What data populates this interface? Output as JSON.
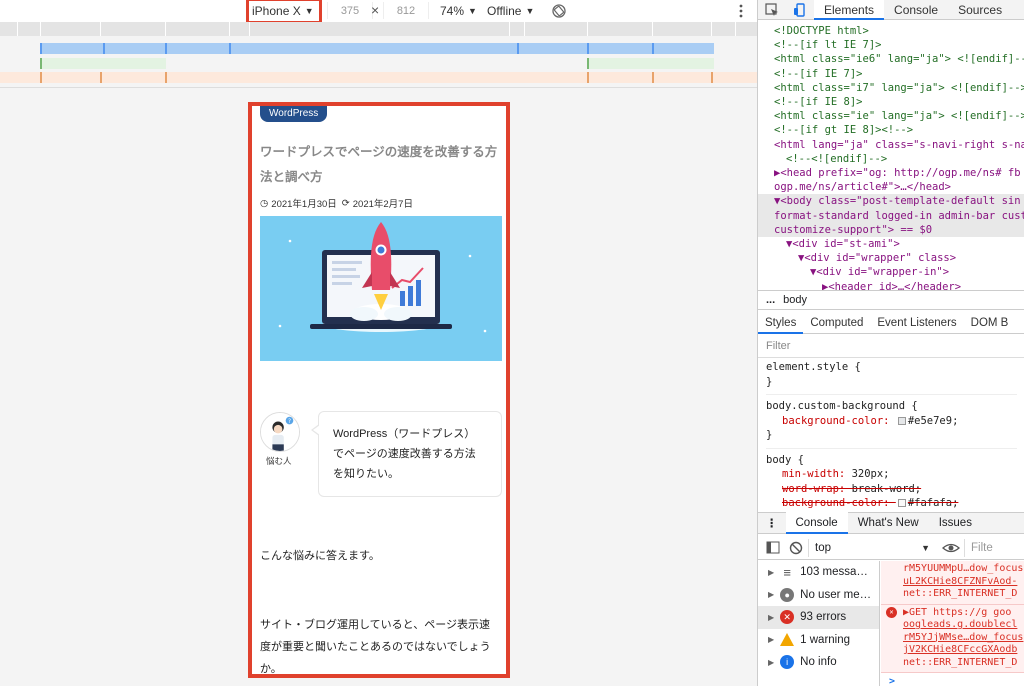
{
  "device_toolbar": {
    "device": "iPhone X",
    "width": "375",
    "times": "×",
    "height": "812",
    "zoom": "74%",
    "throttle": "Offline"
  },
  "page": {
    "category": "WordPress",
    "title": "ワードプレスでページの速度を改善する方法と調べ方",
    "published": "2021年1月30日",
    "updated": "2021年2月7日",
    "avatar_caption": "悩む人",
    "balloon_lines": [
      "WordPress（ワードプレス）",
      "でページの速度改善する方法",
      "を知りたい。"
    ],
    "para1": "こんな悩みに答えます。",
    "para2_lines": [
      "サイト・ブログ運用していると、ページ表示速",
      "度が重要と聞いたことあるのではないでしょう",
      "か。"
    ]
  },
  "devtools": {
    "tabs": [
      "Elements",
      "Console",
      "Sources"
    ],
    "tree": [
      {
        "t": "<!DOCTYPE html>",
        "cls": "c",
        "indent": 0
      },
      {
        "t": "<!--[if lt IE 7]>",
        "cls": "c",
        "indent": 0
      },
      {
        "t": "<html class=\"ie6\" lang=\"ja\"> <![endif]-->",
        "cls": "c",
        "indent": 0
      },
      {
        "t": "<!--[if IE 7]>",
        "cls": "c",
        "indent": 0
      },
      {
        "t": "<html class=\"i7\" lang=\"ja\"> <![endif]-->",
        "cls": "c",
        "indent": 0
      },
      {
        "t": "<!--[if IE 8]>",
        "cls": "c",
        "indent": 0
      },
      {
        "t": "<html class=\"ie\" lang=\"ja\"> <![endif]-->",
        "cls": "c",
        "indent": 0
      },
      {
        "t": "<!--[if gt IE 8]><!-->",
        "cls": "c",
        "indent": 0
      },
      {
        "t": "<html lang=\"ja\" class=\"s-navi-right s-navi",
        "cls": "tag",
        "indent": 0
      },
      {
        "t": "<!--<![endif]-->",
        "cls": "c",
        "indent": 1
      },
      {
        "t": "▶<head prefix=\"og: http://ogp.me/ns# fb",
        "cls": "tag",
        "indent": 0
      },
      {
        "t": "ogp.me/ns/article#\">…</head>",
        "cls": "tag",
        "indent": 0
      },
      {
        "t": "▼<body class=\"post-template-default sin",
        "cls": "tag",
        "indent": 0,
        "sel": true
      },
      {
        "t": "format-standard logged-in admin-bar cust",
        "cls": "tag",
        "indent": 0,
        "sel": true
      },
      {
        "t": "customize-support\"> == $0",
        "cls": "tag",
        "indent": 0,
        "sel": true
      },
      {
        "t": "▼<div id=\"st-ami\">",
        "cls": "tag",
        "indent": 1
      },
      {
        "t": "▼<div id=\"wrapper\" class>",
        "cls": "tag",
        "indent": 2
      },
      {
        "t": "▼<div id=\"wrapper-in\">",
        "cls": "tag",
        "indent": 3
      },
      {
        "t": "▶<header id>…</header>",
        "cls": "tag",
        "indent": 4
      }
    ],
    "breadcrumb": [
      "...",
      "body"
    ],
    "styles_tabs": [
      "Styles",
      "Computed",
      "Event Listeners",
      "DOM B"
    ],
    "filter_placeholder": "Filter",
    "style_rules": [
      {
        "selector": "element.style {",
        "props": []
      },
      {
        "selector": "body.custom-background {",
        "props": [
          {
            "name": "background-color",
            "value": "#e5e7e9;",
            "swatch": "#e5e7e9",
            "strike": false
          }
        ]
      },
      {
        "selector": "body {",
        "props": [
          {
            "name": "min-width",
            "value": "320px;",
            "strike": false
          },
          {
            "name": "word-wrap",
            "value": "break-word;",
            "strike": true
          },
          {
            "name": "background-color",
            "value": "#fafafa;",
            "swatch": "#fafafa",
            "strike": true
          },
          {
            "name": "counter-reset",
            "value": "stcnt;",
            "strike": false
          }
        ]
      }
    ],
    "drawer_tabs": [
      "Console",
      "What's New",
      "Issues"
    ],
    "context": "top",
    "filter_right": "Filte",
    "sidebar": [
      {
        "label": "103 messa…",
        "icon": "list-icon",
        "color": "#555555"
      },
      {
        "label": "No user me…",
        "icon": "user-icon",
        "color": "#777777"
      },
      {
        "label": "93 errors",
        "icon": "error-icon",
        "color": "#d93025"
      },
      {
        "label": "1 warning",
        "icon": "warning-icon",
        "color": "#f2a600"
      },
      {
        "label": "No info",
        "icon": "info-icon",
        "color": "#1a73e8"
      }
    ],
    "messages": [
      [
        "rM5YUUMMpU…dow_focus",
        "uL2KCHie8CFZNFvAod-",
        "net::ERR_INTERNET_D"
      ],
      [
        "▶GET https://g goo",
        "oogleads.g.doublecl",
        "rM5YJjWMse…dow_focus",
        "jV2KCHie8CFccGXAodb",
        "net::ERR_INTERNET_D"
      ]
    ]
  }
}
